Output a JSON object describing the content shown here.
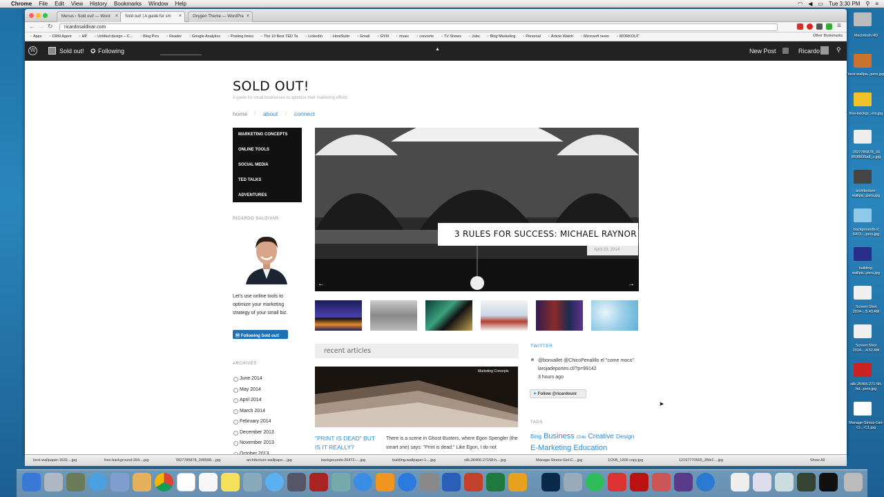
{
  "menubar": {
    "app": "Chrome",
    "items": [
      "File",
      "Edit",
      "View",
      "History",
      "Bookmarks",
      "Window",
      "Help"
    ],
    "clock": "Tue 3:30 PM"
  },
  "tabs": [
    {
      "label": "Menus ‹ Sold out! — Word"
    },
    {
      "label": "Sold out! | A guide for sm"
    },
    {
      "label": "Oxygen Theme — WordPre"
    }
  ],
  "address": "ricardosaldivar.com",
  "bookmarks": [
    "Apps",
    "CRM Agent",
    "HP",
    "Untitled design – C...",
    "Blog Pics",
    "Reader",
    "Google Analytics",
    "Posting times",
    "The 10 Best TED Ta",
    "LinkedIn",
    "HootSuite",
    "Gmail",
    "GYM",
    "music",
    "concerts",
    "TV Shows",
    "Jobs",
    "Blog Marketing",
    "Personal",
    "Article Watch",
    "Microsoft news",
    "WORKOUT"
  ],
  "other_bookmarks": "Other Bookmarks",
  "wpbar": {
    "site": "Sold out!",
    "following": "Following",
    "new_post": "New Post",
    "user": "Ricardo"
  },
  "site": {
    "title": "SOLD OUT!",
    "tagline": "A guide for small businesses to optimize their marketing efforts.",
    "nav": [
      "home",
      "about",
      "connect"
    ]
  },
  "categories": [
    "MARKETING CONCEPTS",
    "ONLINE TOOLS",
    "SOCIAL MEDIA",
    "TED TALKS",
    "ADVENTURES"
  ],
  "author": {
    "heading": "RICARDO SALDIVAR",
    "bio": "Let's use online tools to optimize your marketing strategy of your small biz.",
    "follow": "Following Sold out!"
  },
  "archives": {
    "heading": "ARCHIVES",
    "months": [
      "June 2014",
      "May 2014",
      "April 2014",
      "March 2014",
      "February 2014",
      "December 2013",
      "November 2013",
      "October 2013"
    ]
  },
  "hero": {
    "title": "3 RULES FOR SUCCESS: MICHAEL RAYNOR",
    "date": "April 23, 2014"
  },
  "recent": {
    "heading": "recent articles",
    "tag": "Marketing Concepts",
    "title": "\"PRINT IS DEAD\" BUT IS IT REALLY?",
    "excerpt": "There is a scene in Ghost Busters, where Egon Spengler (the smart one) says: \"Print is dead.\" Like Egon, I do not"
  },
  "twitter": {
    "heading": "TWITTER",
    "tweet": "@bonvallet @ChicoPenalillo el \"come moco\" larojadeportes.cl/?p=99142",
    "time": "3 hours ago",
    "follow": "Follow @ricardounr"
  },
  "tags": {
    "heading": "TAGS",
    "items": [
      "Bing",
      "Business",
      "Chile",
      "Creative",
      "Design",
      "E-Marketing",
      "Education"
    ]
  },
  "downloads": [
    "best-wallpaper-1632....jpg",
    "free-background-264....jpg",
    "7827785878_348598....jpg",
    "architecture-wallpape....jpg",
    "backgrounds-26472-....jpg",
    "building-wallpaper-1....jpg",
    "silk-26466-27158-h....jpg",
    "Manage-Stress-Get-C....jpg",
    "1CKB_1306 copy.jpg",
    "12197770565_35fe2....jpg"
  ],
  "show_all": "Show All",
  "desktop": [
    "Macintosh HD",
    "best-wallpa...pers.jpg",
    "free-backgr...ers.jpg",
    "7827785878_34 8598830a8_z.jpg",
    "architecture-wallpa...pers.jpg",
    "backgrounds-2 6472-...pers.jpg",
    "building-wallpa...pers.jpg",
    "Screen Shot 2014-...5.43 AM",
    "Screen Shot 2014-...4.52 AM",
    "silk-26466-271 58-hd...pers.jpg",
    "Manage-Stress-Get-Cr...-C1.jpg"
  ]
}
